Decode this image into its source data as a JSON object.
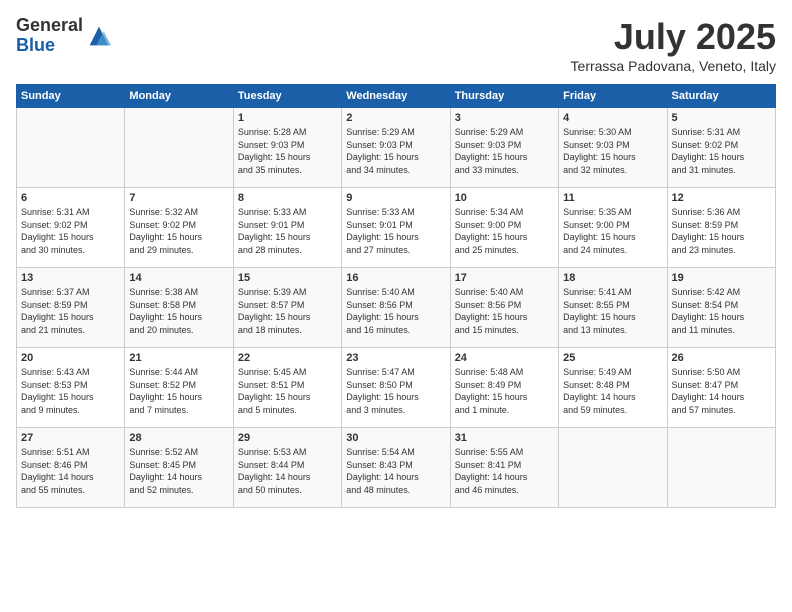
{
  "header": {
    "logo_general": "General",
    "logo_blue": "Blue",
    "month_year": "July 2025",
    "location": "Terrassa Padovana, Veneto, Italy"
  },
  "days_of_week": [
    "Sunday",
    "Monday",
    "Tuesday",
    "Wednesday",
    "Thursday",
    "Friday",
    "Saturday"
  ],
  "weeks": [
    [
      {
        "day": "",
        "info": ""
      },
      {
        "day": "",
        "info": ""
      },
      {
        "day": "1",
        "info": "Sunrise: 5:28 AM\nSunset: 9:03 PM\nDaylight: 15 hours\nand 35 minutes."
      },
      {
        "day": "2",
        "info": "Sunrise: 5:29 AM\nSunset: 9:03 PM\nDaylight: 15 hours\nand 34 minutes."
      },
      {
        "day": "3",
        "info": "Sunrise: 5:29 AM\nSunset: 9:03 PM\nDaylight: 15 hours\nand 33 minutes."
      },
      {
        "day": "4",
        "info": "Sunrise: 5:30 AM\nSunset: 9:03 PM\nDaylight: 15 hours\nand 32 minutes."
      },
      {
        "day": "5",
        "info": "Sunrise: 5:31 AM\nSunset: 9:02 PM\nDaylight: 15 hours\nand 31 minutes."
      }
    ],
    [
      {
        "day": "6",
        "info": "Sunrise: 5:31 AM\nSunset: 9:02 PM\nDaylight: 15 hours\nand 30 minutes."
      },
      {
        "day": "7",
        "info": "Sunrise: 5:32 AM\nSunset: 9:02 PM\nDaylight: 15 hours\nand 29 minutes."
      },
      {
        "day": "8",
        "info": "Sunrise: 5:33 AM\nSunset: 9:01 PM\nDaylight: 15 hours\nand 28 minutes."
      },
      {
        "day": "9",
        "info": "Sunrise: 5:33 AM\nSunset: 9:01 PM\nDaylight: 15 hours\nand 27 minutes."
      },
      {
        "day": "10",
        "info": "Sunrise: 5:34 AM\nSunset: 9:00 PM\nDaylight: 15 hours\nand 25 minutes."
      },
      {
        "day": "11",
        "info": "Sunrise: 5:35 AM\nSunset: 9:00 PM\nDaylight: 15 hours\nand 24 minutes."
      },
      {
        "day": "12",
        "info": "Sunrise: 5:36 AM\nSunset: 8:59 PM\nDaylight: 15 hours\nand 23 minutes."
      }
    ],
    [
      {
        "day": "13",
        "info": "Sunrise: 5:37 AM\nSunset: 8:59 PM\nDaylight: 15 hours\nand 21 minutes."
      },
      {
        "day": "14",
        "info": "Sunrise: 5:38 AM\nSunset: 8:58 PM\nDaylight: 15 hours\nand 20 minutes."
      },
      {
        "day": "15",
        "info": "Sunrise: 5:39 AM\nSunset: 8:57 PM\nDaylight: 15 hours\nand 18 minutes."
      },
      {
        "day": "16",
        "info": "Sunrise: 5:40 AM\nSunset: 8:56 PM\nDaylight: 15 hours\nand 16 minutes."
      },
      {
        "day": "17",
        "info": "Sunrise: 5:40 AM\nSunset: 8:56 PM\nDaylight: 15 hours\nand 15 minutes."
      },
      {
        "day": "18",
        "info": "Sunrise: 5:41 AM\nSunset: 8:55 PM\nDaylight: 15 hours\nand 13 minutes."
      },
      {
        "day": "19",
        "info": "Sunrise: 5:42 AM\nSunset: 8:54 PM\nDaylight: 15 hours\nand 11 minutes."
      }
    ],
    [
      {
        "day": "20",
        "info": "Sunrise: 5:43 AM\nSunset: 8:53 PM\nDaylight: 15 hours\nand 9 minutes."
      },
      {
        "day": "21",
        "info": "Sunrise: 5:44 AM\nSunset: 8:52 PM\nDaylight: 15 hours\nand 7 minutes."
      },
      {
        "day": "22",
        "info": "Sunrise: 5:45 AM\nSunset: 8:51 PM\nDaylight: 15 hours\nand 5 minutes."
      },
      {
        "day": "23",
        "info": "Sunrise: 5:47 AM\nSunset: 8:50 PM\nDaylight: 15 hours\nand 3 minutes."
      },
      {
        "day": "24",
        "info": "Sunrise: 5:48 AM\nSunset: 8:49 PM\nDaylight: 15 hours\nand 1 minute."
      },
      {
        "day": "25",
        "info": "Sunrise: 5:49 AM\nSunset: 8:48 PM\nDaylight: 14 hours\nand 59 minutes."
      },
      {
        "day": "26",
        "info": "Sunrise: 5:50 AM\nSunset: 8:47 PM\nDaylight: 14 hours\nand 57 minutes."
      }
    ],
    [
      {
        "day": "27",
        "info": "Sunrise: 5:51 AM\nSunset: 8:46 PM\nDaylight: 14 hours\nand 55 minutes."
      },
      {
        "day": "28",
        "info": "Sunrise: 5:52 AM\nSunset: 8:45 PM\nDaylight: 14 hours\nand 52 minutes."
      },
      {
        "day": "29",
        "info": "Sunrise: 5:53 AM\nSunset: 8:44 PM\nDaylight: 14 hours\nand 50 minutes."
      },
      {
        "day": "30",
        "info": "Sunrise: 5:54 AM\nSunset: 8:43 PM\nDaylight: 14 hours\nand 48 minutes."
      },
      {
        "day": "31",
        "info": "Sunrise: 5:55 AM\nSunset: 8:41 PM\nDaylight: 14 hours\nand 46 minutes."
      },
      {
        "day": "",
        "info": ""
      },
      {
        "day": "",
        "info": ""
      }
    ]
  ]
}
